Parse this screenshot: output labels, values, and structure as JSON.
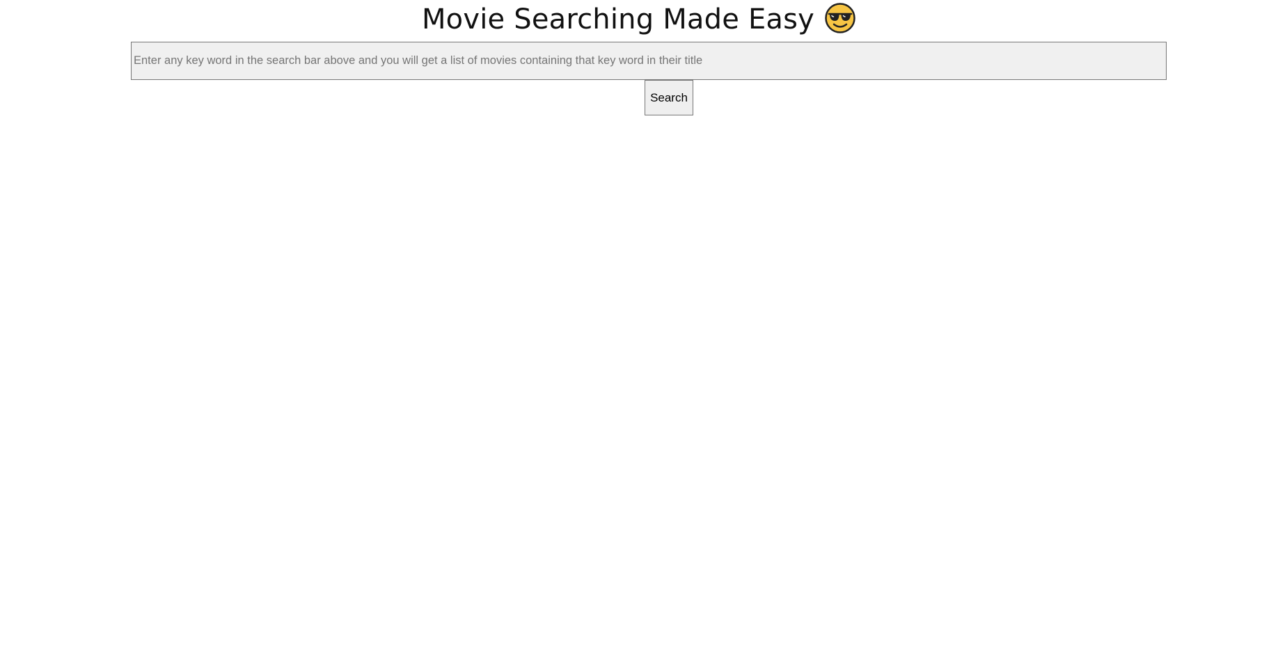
{
  "header": {
    "title": "Movie Searching Made Easy",
    "emoji_icon": "smiling-face-with-sunglasses-icon"
  },
  "search": {
    "value": "",
    "placeholder": "Enter any key word in the search bar above and you will get a list of movies containing that key word in their title",
    "button_label": "Search"
  },
  "results": [],
  "colors": {
    "background": "#ffffff",
    "input_background": "#f0f0f0",
    "button_background": "#efefef",
    "border": "#767676",
    "emoji_face": "#f7c544",
    "emoji_outline": "#222222"
  }
}
